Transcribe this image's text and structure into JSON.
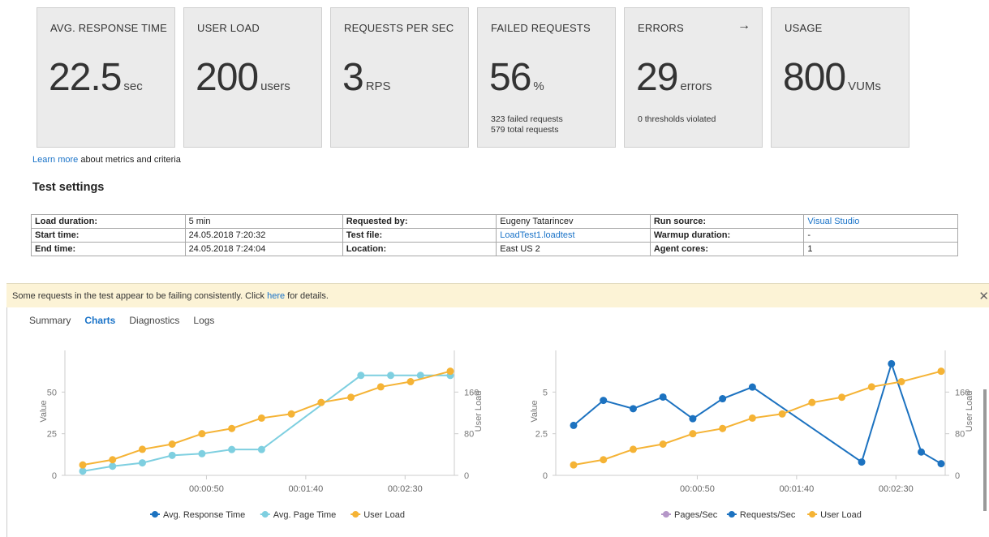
{
  "tiles": [
    {
      "title": "AVG. RESPONSE TIME",
      "value": "22.5",
      "unit": "sec",
      "sub": []
    },
    {
      "title": "USER LOAD",
      "value": "200",
      "unit": "users",
      "sub": []
    },
    {
      "title": "REQUESTS PER SEC",
      "value": "3",
      "unit": "RPS",
      "sub": []
    },
    {
      "title": "FAILED REQUESTS",
      "value": "56",
      "unit": "%",
      "sub": [
        "323 failed requests",
        "579 total requests"
      ]
    },
    {
      "title": "ERRORS",
      "value": "29",
      "unit": "errors",
      "sub": [
        "0 thresholds violated"
      ],
      "arrow": "→"
    },
    {
      "title": "USAGE",
      "value": "800",
      "unit": "VUMs",
      "sub": []
    }
  ],
  "learn_more": {
    "link": "Learn more",
    "text": " about metrics and criteria"
  },
  "settings": {
    "title": "Test settings",
    "rows": [
      [
        {
          "t": "Load duration:",
          "lbl": true
        },
        {
          "t": "5 min"
        },
        {
          "t": "Requested by:",
          "lbl": true
        },
        {
          "t": "Eugeny Tatarincev"
        },
        {
          "t": "Run source:",
          "lbl": true
        },
        {
          "t": "Visual Studio",
          "link": true
        }
      ],
      [
        {
          "t": "Start time:",
          "lbl": true
        },
        {
          "t": "24.05.2018 7:20:32"
        },
        {
          "t": "Test file:",
          "lbl": true
        },
        {
          "t": "LoadTest1.loadtest",
          "link": true
        },
        {
          "t": "Warmup duration:",
          "lbl": true
        },
        {
          "t": "-"
        }
      ],
      [
        {
          "t": "End time:",
          "lbl": true
        },
        {
          "t": "24.05.2018 7:24:04"
        },
        {
          "t": "Location:",
          "lbl": true
        },
        {
          "t": "East US 2"
        },
        {
          "t": "Agent cores:",
          "lbl": true
        },
        {
          "t": "1"
        }
      ]
    ]
  },
  "banner": {
    "before": "Some requests in the test appear to be failing consistently. Click ",
    "link": "here",
    "after": " for details.",
    "close": "✕"
  },
  "tabs": [
    {
      "label": "Summary",
      "active": false
    },
    {
      "label": "Charts",
      "active": true
    },
    {
      "label": "Diagnostics",
      "active": false
    },
    {
      "label": "Logs",
      "active": false
    }
  ],
  "colors": {
    "yellow": "#f5b335",
    "lightblue": "#7ecfe0",
    "blue": "#1c72c0",
    "purple": "#b597c8",
    "axis": "#999999"
  },
  "chart_data": [
    {
      "type": "line",
      "ylabel": "Value",
      "y2label": "User Load",
      "ylim": [
        0,
        75
      ],
      "yticks": [
        "0",
        "25",
        "50"
      ],
      "y2lim": [
        0,
        240
      ],
      "y2ticks": [
        "0",
        "80",
        "160"
      ],
      "xticks": [
        "00:00:50",
        "00:01:40",
        "00:02:30"
      ],
      "series": [
        {
          "name": "Avg. Response Time",
          "axis": "left",
          "color": "#1c72c0",
          "x": [],
          "values": []
        },
        {
          "name": "Avg. Page Time",
          "axis": "left",
          "color": "#7ecfe0",
          "x": [
            0,
            15,
            30,
            45,
            60,
            75,
            90,
            140,
            155,
            170,
            185
          ],
          "values": [
            2.5,
            5.5,
            7.5,
            12,
            13,
            15.5,
            15.5,
            60,
            60,
            60,
            60
          ]
        },
        {
          "name": "User Load",
          "axis": "right",
          "color": "#f5b335",
          "x": [
            0,
            15,
            30,
            45,
            60,
            75,
            90,
            105,
            120,
            135,
            150,
            165,
            185
          ],
          "values": [
            20,
            30,
            50,
            60,
            80,
            90,
            110,
            118,
            140,
            150,
            170,
            180,
            200
          ]
        }
      ]
    },
    {
      "type": "line",
      "ylabel": "Value",
      "y2label": "User Load",
      "ylim": [
        0,
        7.5
      ],
      "yticks": [
        "0",
        "2.5",
        "5"
      ],
      "y2lim": [
        0,
        240
      ],
      "y2ticks": [
        "0",
        "80",
        "160"
      ],
      "xticks": [
        "00:00:50",
        "00:01:40",
        "00:02:30"
      ],
      "series": [
        {
          "name": "Pages/Sec",
          "axis": "left",
          "color": "#b597c8",
          "x": [],
          "values": []
        },
        {
          "name": "Requests/Sec",
          "axis": "left",
          "color": "#1c72c0",
          "x": [
            0,
            15,
            30,
            45,
            60,
            75,
            90,
            145,
            160,
            175,
            185
          ],
          "values": [
            3,
            4.5,
            4,
            4.7,
            3.4,
            4.6,
            5.3,
            0.8,
            6.7,
            1.4,
            0.7
          ]
        },
        {
          "name": "User Load",
          "axis": "right",
          "color": "#f5b335",
          "x": [
            0,
            15,
            30,
            45,
            60,
            75,
            90,
            105,
            120,
            135,
            150,
            165,
            185
          ],
          "values": [
            20,
            30,
            50,
            60,
            80,
            90,
            110,
            118,
            140,
            150,
            170,
            180,
            200
          ]
        }
      ]
    }
  ]
}
